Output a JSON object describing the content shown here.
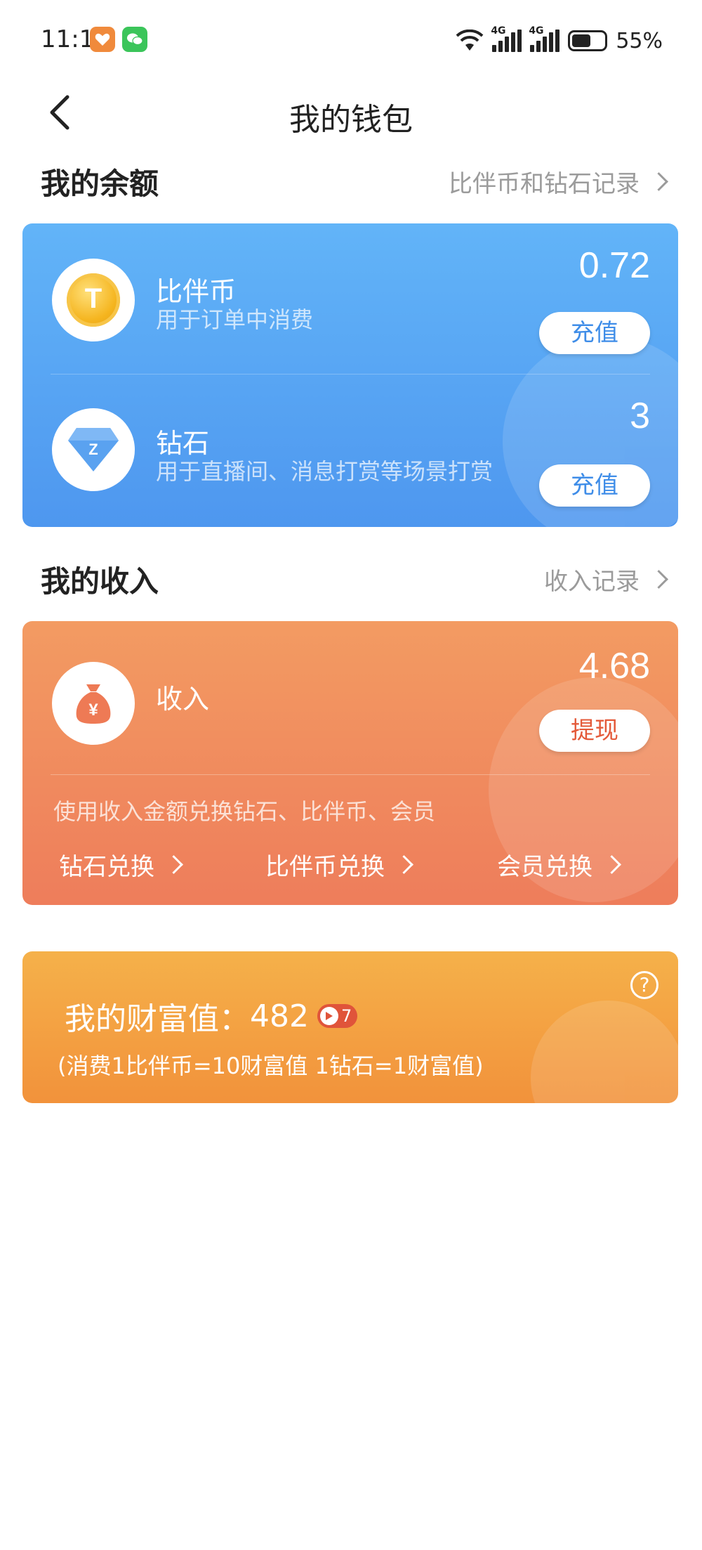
{
  "status_bar": {
    "time": "11:15",
    "network_1": "4G",
    "network_2": "4G",
    "battery": "55%"
  },
  "nav": {
    "title": "我的钱包"
  },
  "balance_section": {
    "title": "我的余额",
    "link": "比伴币和钻石记录",
    "items": [
      {
        "name": "比伴币",
        "desc": "用于订单中消费",
        "amount": "0.72",
        "button": "充值",
        "icon": "coin-icon"
      },
      {
        "name": "钻石",
        "desc": "用于直播间、消息打赏等场景打赏",
        "amount": "3",
        "button": "充值",
        "icon": "diamond-icon"
      }
    ]
  },
  "income_section": {
    "title": "我的收入",
    "link": "收入记录",
    "label": "收入",
    "amount": "4.68",
    "button": "提现",
    "hint": "使用收入金额兑换钻石、比伴币、会员",
    "exchanges": [
      "钻石兑换",
      "比伴币兑换",
      "会员兑换"
    ]
  },
  "wealth": {
    "title": "我的财富值：",
    "value": "482",
    "rank": "7",
    "note": "(消费1比伴币=10财富值 1钻石=1财富值)"
  },
  "colors": {
    "balance_card": "#56a6f4",
    "income_card": "#f08a5e",
    "wealth_card": "#f3a142"
  }
}
